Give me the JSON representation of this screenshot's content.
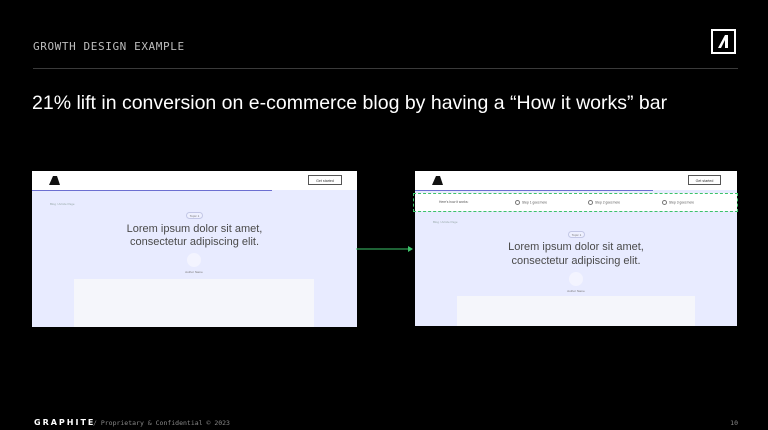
{
  "slide": {
    "kicker": "GROWTH DESIGN EXAMPLE",
    "headline": "21% lift in conversion on e-commerce blog by having a “How it works” bar",
    "page_number": "10"
  },
  "footer": {
    "brand": "GRAPHITE",
    "note": "/ Proprietary & Confidential © 2023"
  },
  "mock_before": {
    "cta": "Get started",
    "breadcrumb": "Blog / Article Page",
    "pill": "Topic 1",
    "title_line1": "Lorem ipsum dolor sit amet,",
    "title_line2": "consectetur adipiscing elit.",
    "author": "Author Name"
  },
  "mock_after": {
    "cta": "Get started",
    "breadcrumb": "Blog / Article Page",
    "steps_intro": "Here's how it works:",
    "steps": [
      "Step 1 goes here",
      "Step 2 goes here",
      "Step 3 goes here"
    ],
    "pill": "Topic 1",
    "title_line1": "Lorem ipsum dolor sit amet,",
    "title_line2": "consectetur adipiscing elit.",
    "author": "Author Name"
  },
  "colors": {
    "background": "#000000",
    "mock_bg": "#e8ebff",
    "highlight": "#3cc36a"
  }
}
